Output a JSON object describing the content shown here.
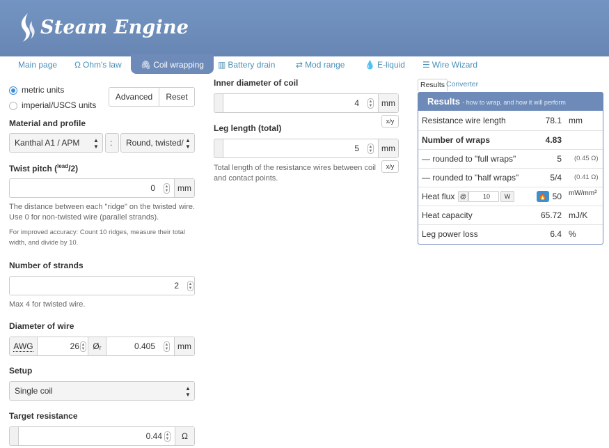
{
  "app": {
    "title": "Steam Engine"
  },
  "nav": {
    "main_page": "Main page",
    "ohms_law": "Ohm's law",
    "coil_wrapping": "Coil wrapping",
    "battery_drain": "Battery drain",
    "mod_range": "Mod range",
    "e_liquid": "E-liquid",
    "wire_wizard": "Wire Wizard"
  },
  "units": {
    "metric": "metric units",
    "imperial": "imperial/USCS units",
    "selected": "metric"
  },
  "buttons": {
    "advanced": "Advanced",
    "reset": "Reset"
  },
  "material": {
    "label": "Material and profile",
    "material_value": "Kanthal A1 / APM",
    "separator": ":",
    "profile_value": "Round, twisted/"
  },
  "twist": {
    "label_prefix": "Twist pitch (",
    "label_sup": "lead",
    "label_suffix": "/2)",
    "value": "0",
    "unit": "mm",
    "help1": "The distance between each \"ridge\" on the twisted wire. Use 0 for non-twisted wire (parallel strands).",
    "help2": "For improved accuracy: Count 10 ridges, measure their total width, and divide by 10."
  },
  "strands": {
    "label": "Number of strands",
    "value": "2",
    "help": "Max 4 for twisted wire."
  },
  "diameter": {
    "label": "Diameter of wire",
    "awg_label": "AWG",
    "awg_value": "26",
    "dia_label": "Øᵣ",
    "dia_value": "0.405",
    "unit": "mm"
  },
  "setup": {
    "label": "Setup",
    "value": "Single coil"
  },
  "target": {
    "label": "Target resistance",
    "value": "0.44",
    "unit": "Ω"
  },
  "inner": {
    "label": "Inner diameter of coil",
    "value": "4",
    "unit": "mm",
    "frac": "x/y"
  },
  "leg": {
    "label": "Leg length (total)",
    "value": "5",
    "unit": "mm",
    "frac": "x/y",
    "help": "Total length of the resistance wires between coil and contact points."
  },
  "result_tabs": {
    "results": "Results",
    "converter": "Converter"
  },
  "results": {
    "title": "Results",
    "subtitle": "- how to wrap, and how it will perform",
    "rows": [
      {
        "label": "Resistance wire length",
        "value": "78.1",
        "unit": "mm"
      },
      {
        "label": "Number of wraps",
        "value": "4.83",
        "unit": ""
      },
      {
        "label": "— rounded to \"full wraps\"",
        "value": "5",
        "unit": "(0.45 Ω)"
      },
      {
        "label": "— rounded to \"half wraps\"",
        "value": "5/4",
        "unit": "(0.41 Ω)"
      },
      {
        "label": "Heat flux",
        "value": "50",
        "unit": "mW/mm²"
      },
      {
        "label": "Heat capacity",
        "value": "65.72",
        "unit": "mJ/K"
      },
      {
        "label": "Leg power loss",
        "value": "6.4",
        "unit": "%"
      }
    ],
    "heat_flux_at": "@",
    "heat_flux_watts": "10",
    "heat_flux_w_unit": "W"
  },
  "colors": {
    "header": "#6d8ab8",
    "link": "#4a90b6",
    "accent": "#3c8dd8"
  }
}
